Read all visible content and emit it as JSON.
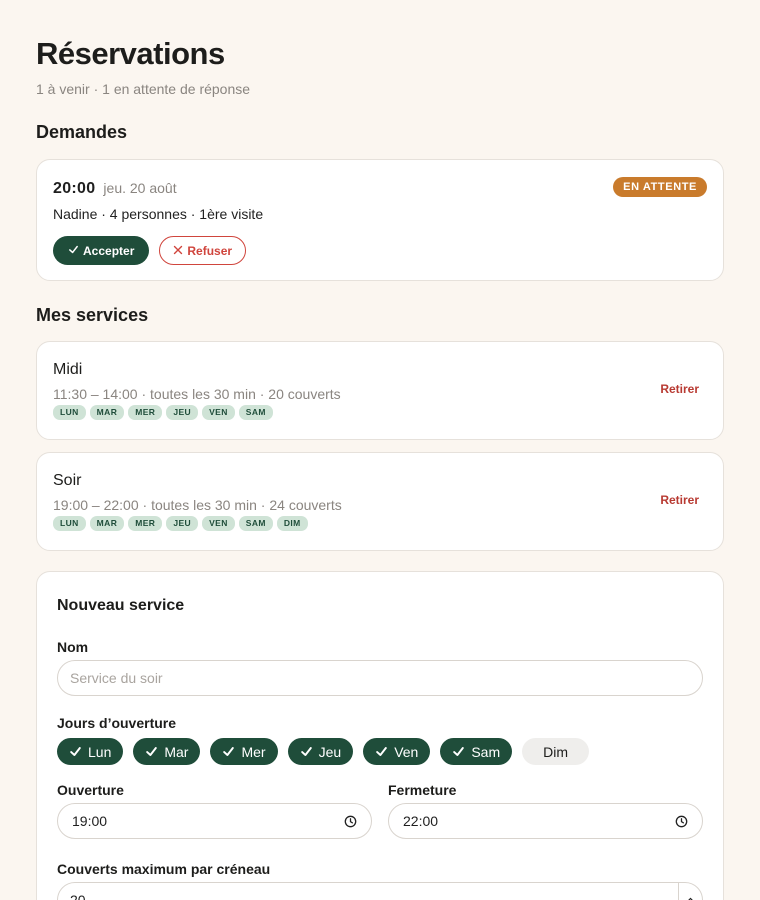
{
  "header": {
    "title": "Réservations",
    "subtitle": "1 à venir · 1 en attente de réponse"
  },
  "requests": {
    "section_title": "Demandes",
    "items": [
      {
        "time": "20:00",
        "date": "jeu. 20 août",
        "info": "Nadine · 4 personnes · 1ère visite",
        "status": "EN ATTENTE",
        "accept_label": "Accepter",
        "refuse_label": "Refuser"
      }
    ]
  },
  "services": {
    "section_title": "Mes services",
    "remove_label": "Retirer",
    "items": [
      {
        "name": "Midi",
        "meta": "11:30 – 14:00 · toutes les 30 min · 20 couverts",
        "days": [
          "LUN",
          "MAR",
          "MER",
          "JEU",
          "VEN",
          "SAM"
        ]
      },
      {
        "name": "Soir",
        "meta": "19:00 – 22:00 · toutes les 30 min · 24 couverts",
        "days": [
          "LUN",
          "MAR",
          "MER",
          "JEU",
          "VEN",
          "SAM",
          "DIM"
        ]
      }
    ]
  },
  "new_service": {
    "title": "Nouveau service",
    "name_label": "Nom",
    "name_value": "",
    "name_placeholder": "Service du soir",
    "days_label": "Jours d’ouverture",
    "days": [
      {
        "label": "Lun",
        "selected": true
      },
      {
        "label": "Mar",
        "selected": true
      },
      {
        "label": "Mer",
        "selected": true
      },
      {
        "label": "Jeu",
        "selected": true
      },
      {
        "label": "Ven",
        "selected": true
      },
      {
        "label": "Sam",
        "selected": true
      },
      {
        "label": "Dim",
        "selected": false
      }
    ],
    "open_label": "Ouverture",
    "open_value": "19:00",
    "close_label": "Fermeture",
    "close_value": "22:00",
    "max_label": "Couverts maximum par créneau",
    "max_value": "20"
  },
  "colors": {
    "background": "#fbf6f0",
    "brand_green": "#1f4d3a",
    "pending_orange": "#c97b2c",
    "danger_red": "#d0453d",
    "tag_green_bg": "#cfe3d6"
  },
  "icons": {
    "accept": "check-icon",
    "refuse": "x-icon",
    "day_selected": "check-icon",
    "time": "clock-icon",
    "stepper": "chevron-up-icon"
  }
}
